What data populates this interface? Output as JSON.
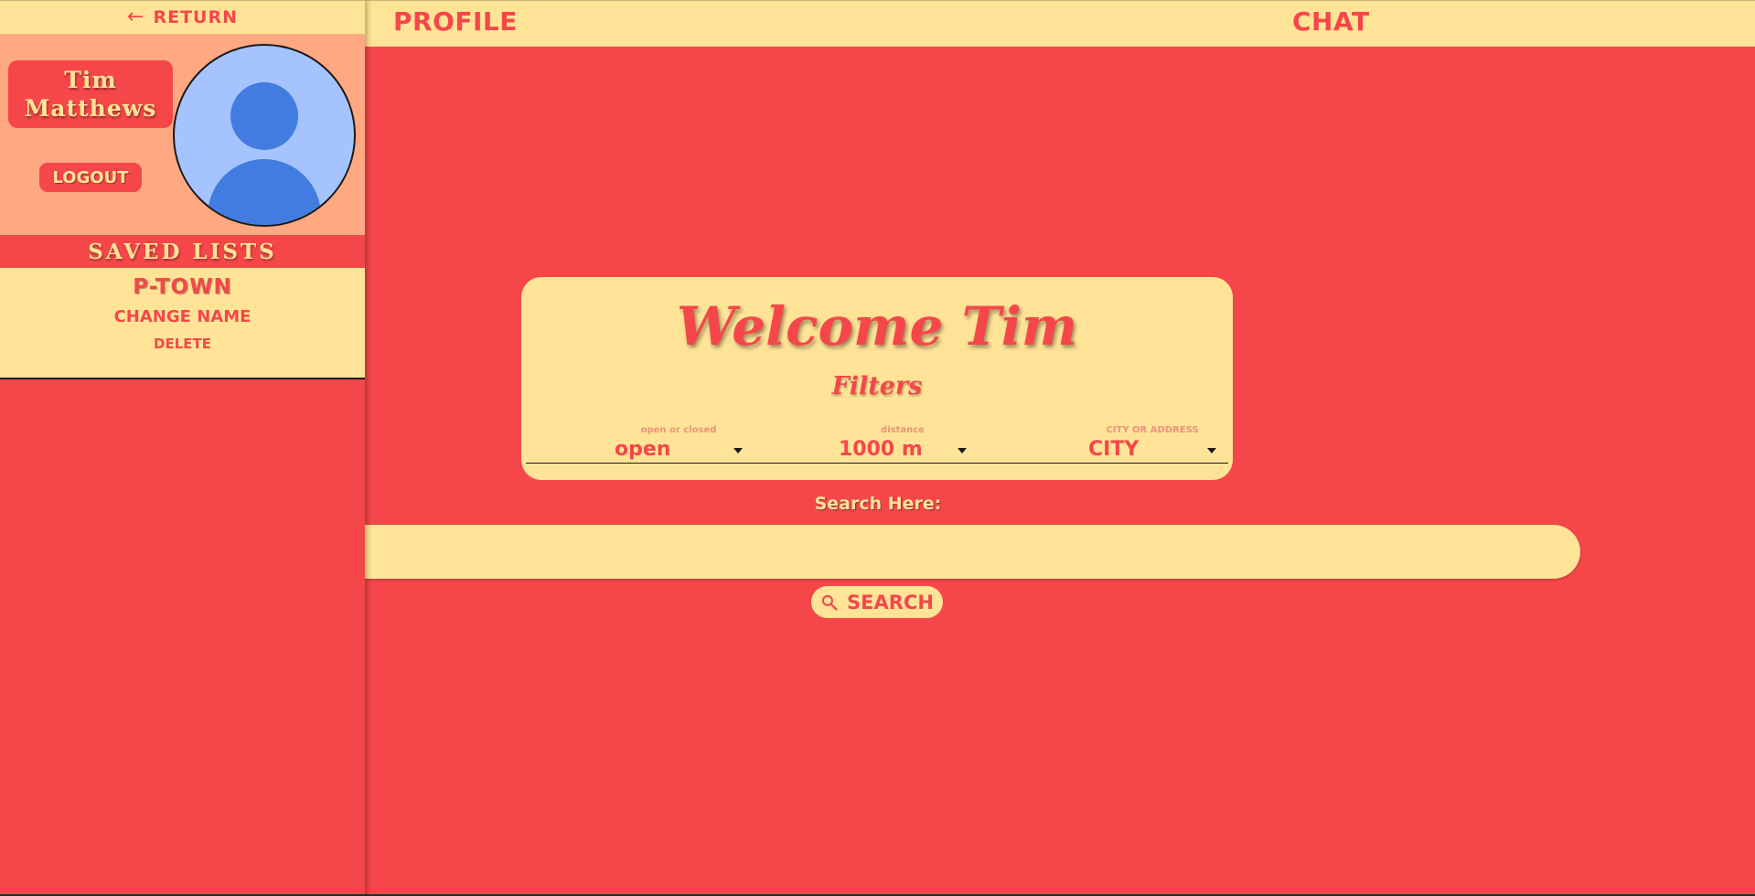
{
  "sidebar": {
    "return_label": "RETURN",
    "user": {
      "first_name": "Tim",
      "last_name": "Matthews"
    },
    "logout_label": "LOGOUT",
    "saved_lists_title": "SAVED LISTS",
    "saved_lists": [
      {
        "name": "P-TOWN",
        "change_name_label": "CHANGE NAME",
        "delete_label": "DELETE"
      }
    ]
  },
  "nav": {
    "tabs": [
      {
        "label": "PROFILE"
      },
      {
        "label": "CHAT"
      }
    ]
  },
  "welcome": {
    "title": "Welcome Tim",
    "filters_title": "Filters",
    "filters": [
      {
        "label": "open or closed",
        "value": "open"
      },
      {
        "label": "distance",
        "value": "1000 m"
      },
      {
        "label": "CITY OR ADDRESS",
        "value": "CITY"
      }
    ]
  },
  "search": {
    "label": "Search Here:",
    "value": "",
    "button_label": "SEARCH"
  },
  "colors": {
    "primary_red": "#f5474a",
    "cream": "#ffe497",
    "peach": "#ffa882",
    "avatar_bg": "#a5c4ff",
    "avatar_fg": "#437ce0"
  },
  "icons": {
    "return": "arrow-left-icon",
    "avatar": "user-avatar-icon",
    "search": "search-icon",
    "dropdown": "caret-down-icon"
  }
}
